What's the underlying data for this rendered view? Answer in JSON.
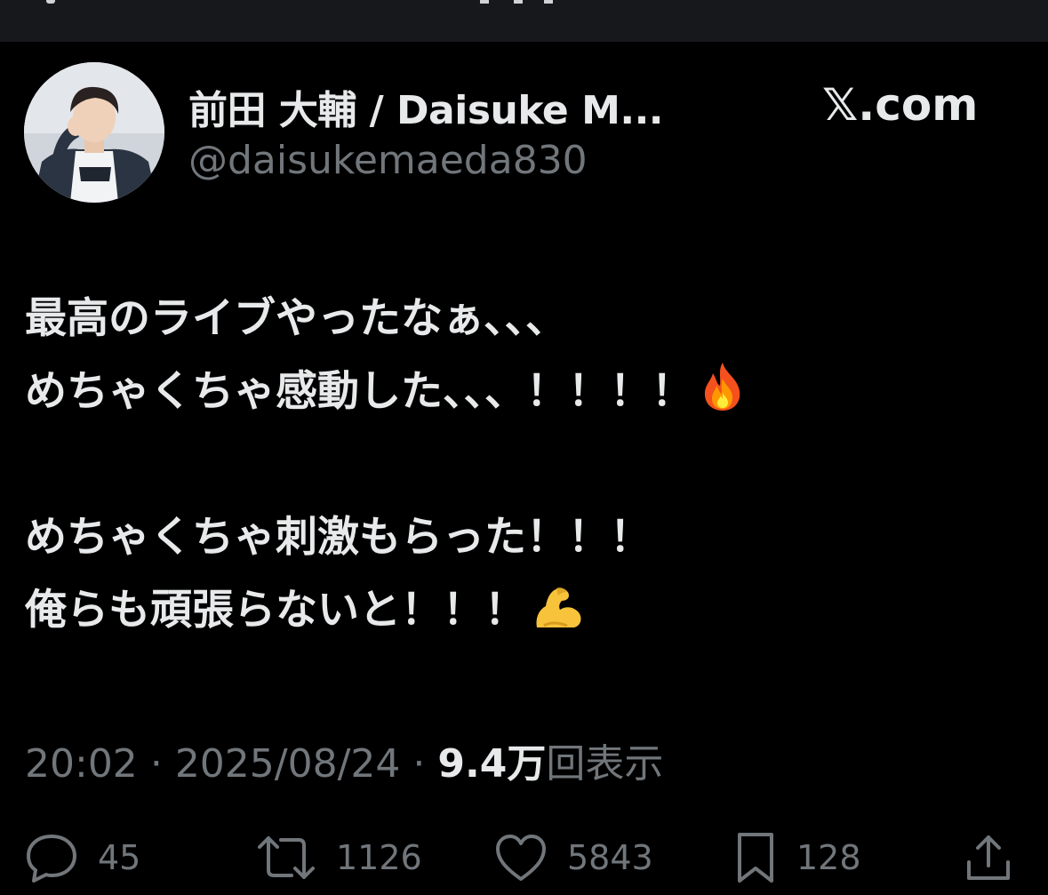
{
  "author": {
    "display_name": "前田 大輔 / Daisuke M...",
    "handle": "@daisukemaeda830",
    "avatar": "profile-photo"
  },
  "brand": {
    "label": "𝕏.com"
  },
  "tweet": {
    "lines": [
      "最高のライブやったなぁ、、、",
      "めちゃくちゃ感動した、、、！！！！",
      "",
      "めちゃくちゃ刺激もらった！！！",
      "俺らも頑張らないと！！！"
    ],
    "emojis": {
      "line2": "fire-emoji",
      "line5": "flexed-biceps-emoji"
    }
  },
  "meta": {
    "time": "20:02",
    "separator": "·",
    "date": "2025/08/24",
    "views_count": "9.4万",
    "views_label": "回表示"
  },
  "actions": {
    "replies": "45",
    "reposts": "1126",
    "likes": "5843",
    "bookmarks": "128"
  },
  "colors": {
    "background": "#000000",
    "text": "#e7e9ea",
    "secondary": "#71767b",
    "header_bar": "#16181c"
  }
}
